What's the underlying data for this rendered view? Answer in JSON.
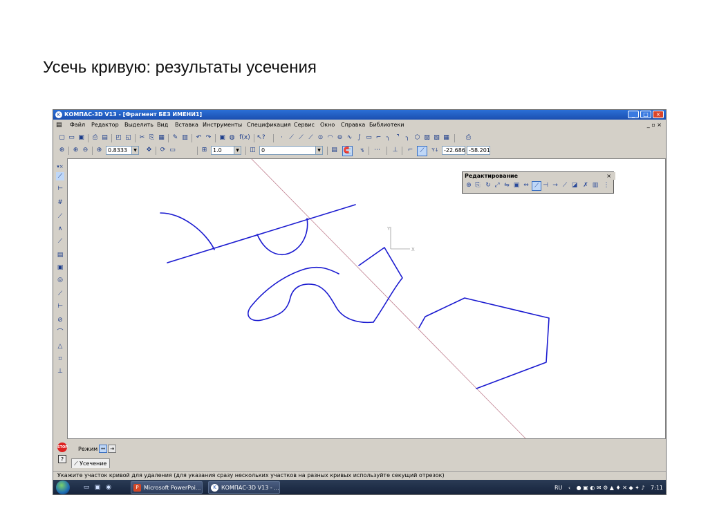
{
  "slide": {
    "title": "Усечь кривую: результаты усечения"
  },
  "window": {
    "title": "КОМПАС-3D V13 - [Фрагмент БЕЗ ИМЕНИ1]",
    "controls": {
      "minimize": "_",
      "maximize": "□",
      "close": "×"
    }
  },
  "menu": {
    "items": [
      "Файл",
      "Редактор",
      "Выделить",
      "Вид",
      "Вставка",
      "Инструменты",
      "Спецификация",
      "Сервис",
      "Окно",
      "Справка",
      "Библиотеки"
    ],
    "mdi_controls": "_ ▫ ×"
  },
  "toolbar2": {
    "zoom_value": "0.8333",
    "line_step": "1.0",
    "layer_value": "0",
    "coord_x": "-22.686",
    "coord_y": "-58.201"
  },
  "panel": {
    "title": "Редактирование",
    "close": "×"
  },
  "axis": {
    "y_label": "Y",
    "x_label": "X"
  },
  "props": {
    "stop_label": "STOP",
    "help_label": "?",
    "mode_label": "Режим",
    "tab_label": "Усечение"
  },
  "status": {
    "hint": "Укажите участок кривой для удаления (для указания сразу нескольких участков на разных кривых используйте секущий отрезок)"
  },
  "taskbar": {
    "tasks": [
      "Microsoft PowerPoi...",
      "КОМПАС-3D V13 - ..."
    ],
    "lang": "RU",
    "time": "7:11"
  },
  "colors": {
    "geometry": "#1a1ad0",
    "aux_line": "#c08090",
    "axis": "#9a9a9a"
  }
}
